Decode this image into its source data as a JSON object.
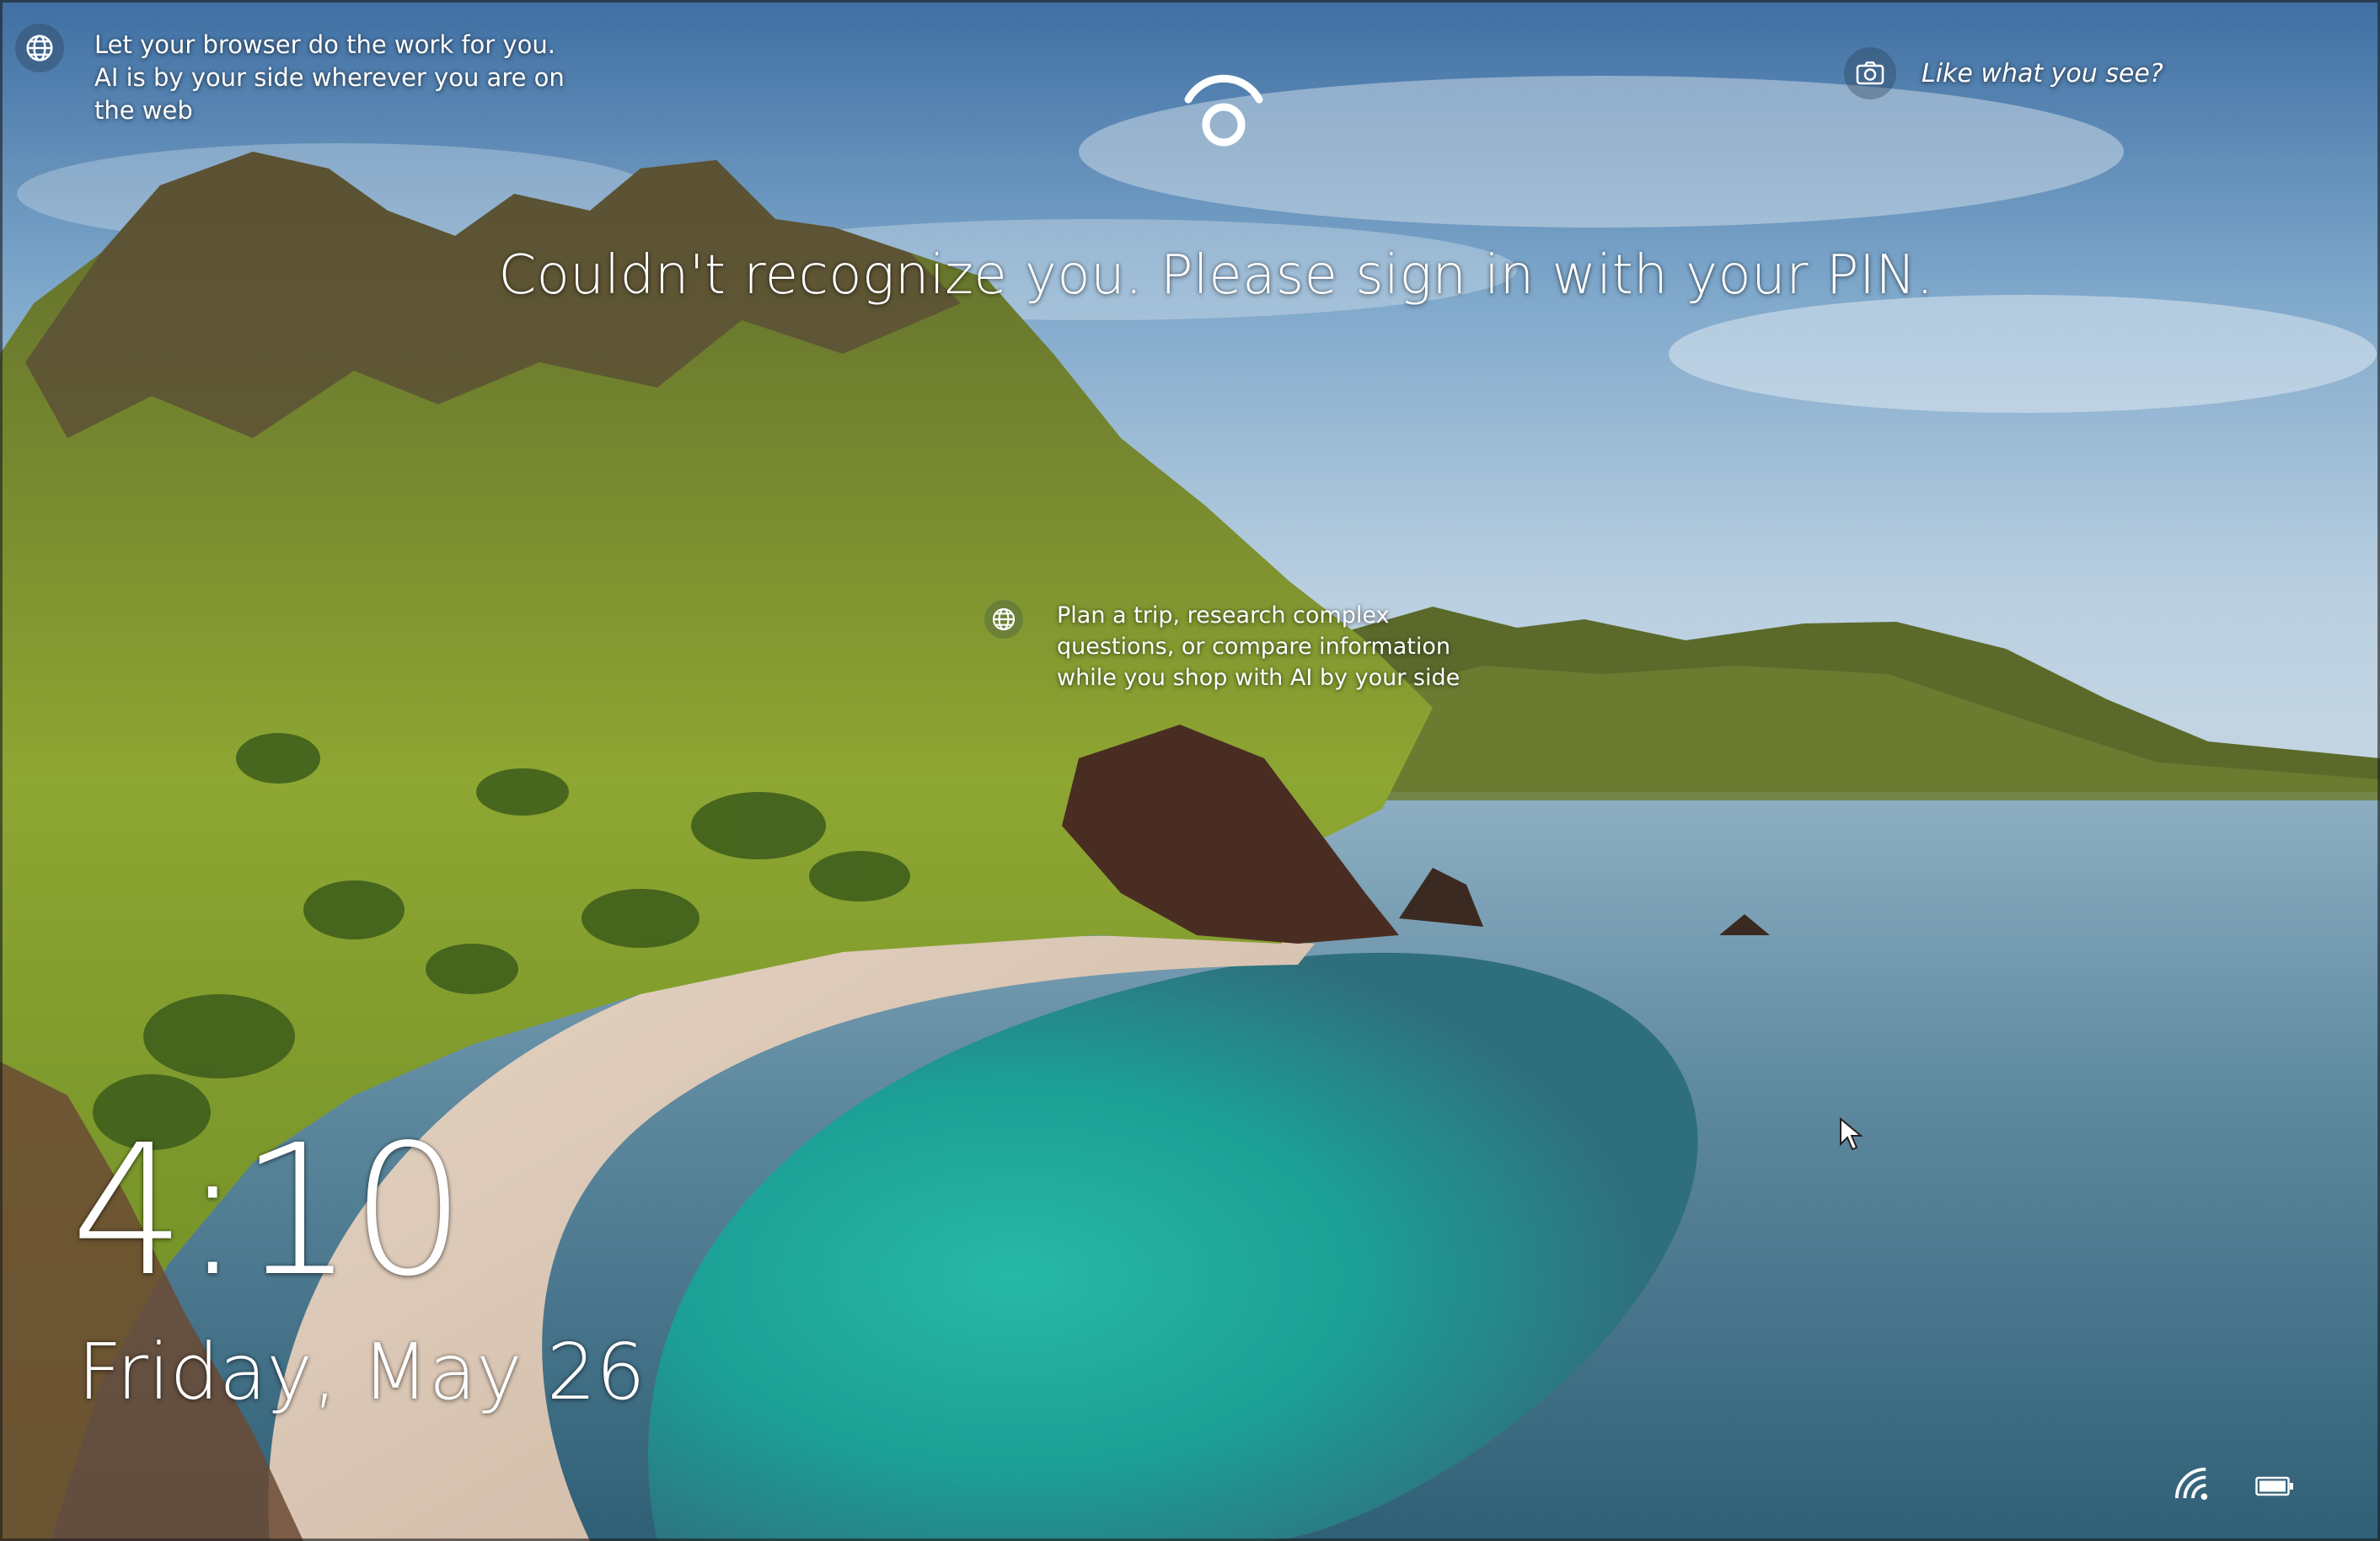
{
  "lock_screen": {
    "tip_top_left": {
      "icon": "globe-icon",
      "text": "Let your browser do the work for you. AI is by your side wherever you are on the web"
    },
    "like_prompt": {
      "icon": "camera-icon",
      "text": "Like what you see?"
    },
    "face_recognition_icon": "windows-hello-face-icon",
    "status_message": "Couldn't recognize you. Please sign in with your PIN.",
    "tip_middle": {
      "icon": "globe-icon",
      "text": "Plan a trip, research complex questions, or compare information while you shop with AI by your side"
    },
    "clock": {
      "time": "4:10",
      "date": "Friday, May 26"
    },
    "status_icons": {
      "network": "wifi-signal-icon",
      "battery": "battery-icon"
    },
    "pointer": "mouse-cursor-icon"
  },
  "colors": {
    "text": "#ffffff",
    "sky": "#6f9fc4",
    "sea_turquoise": "#1fb3a4",
    "sea_deep": "#3f6f86",
    "hills": "#7c9a2e",
    "sand": "#d8c6b6"
  }
}
